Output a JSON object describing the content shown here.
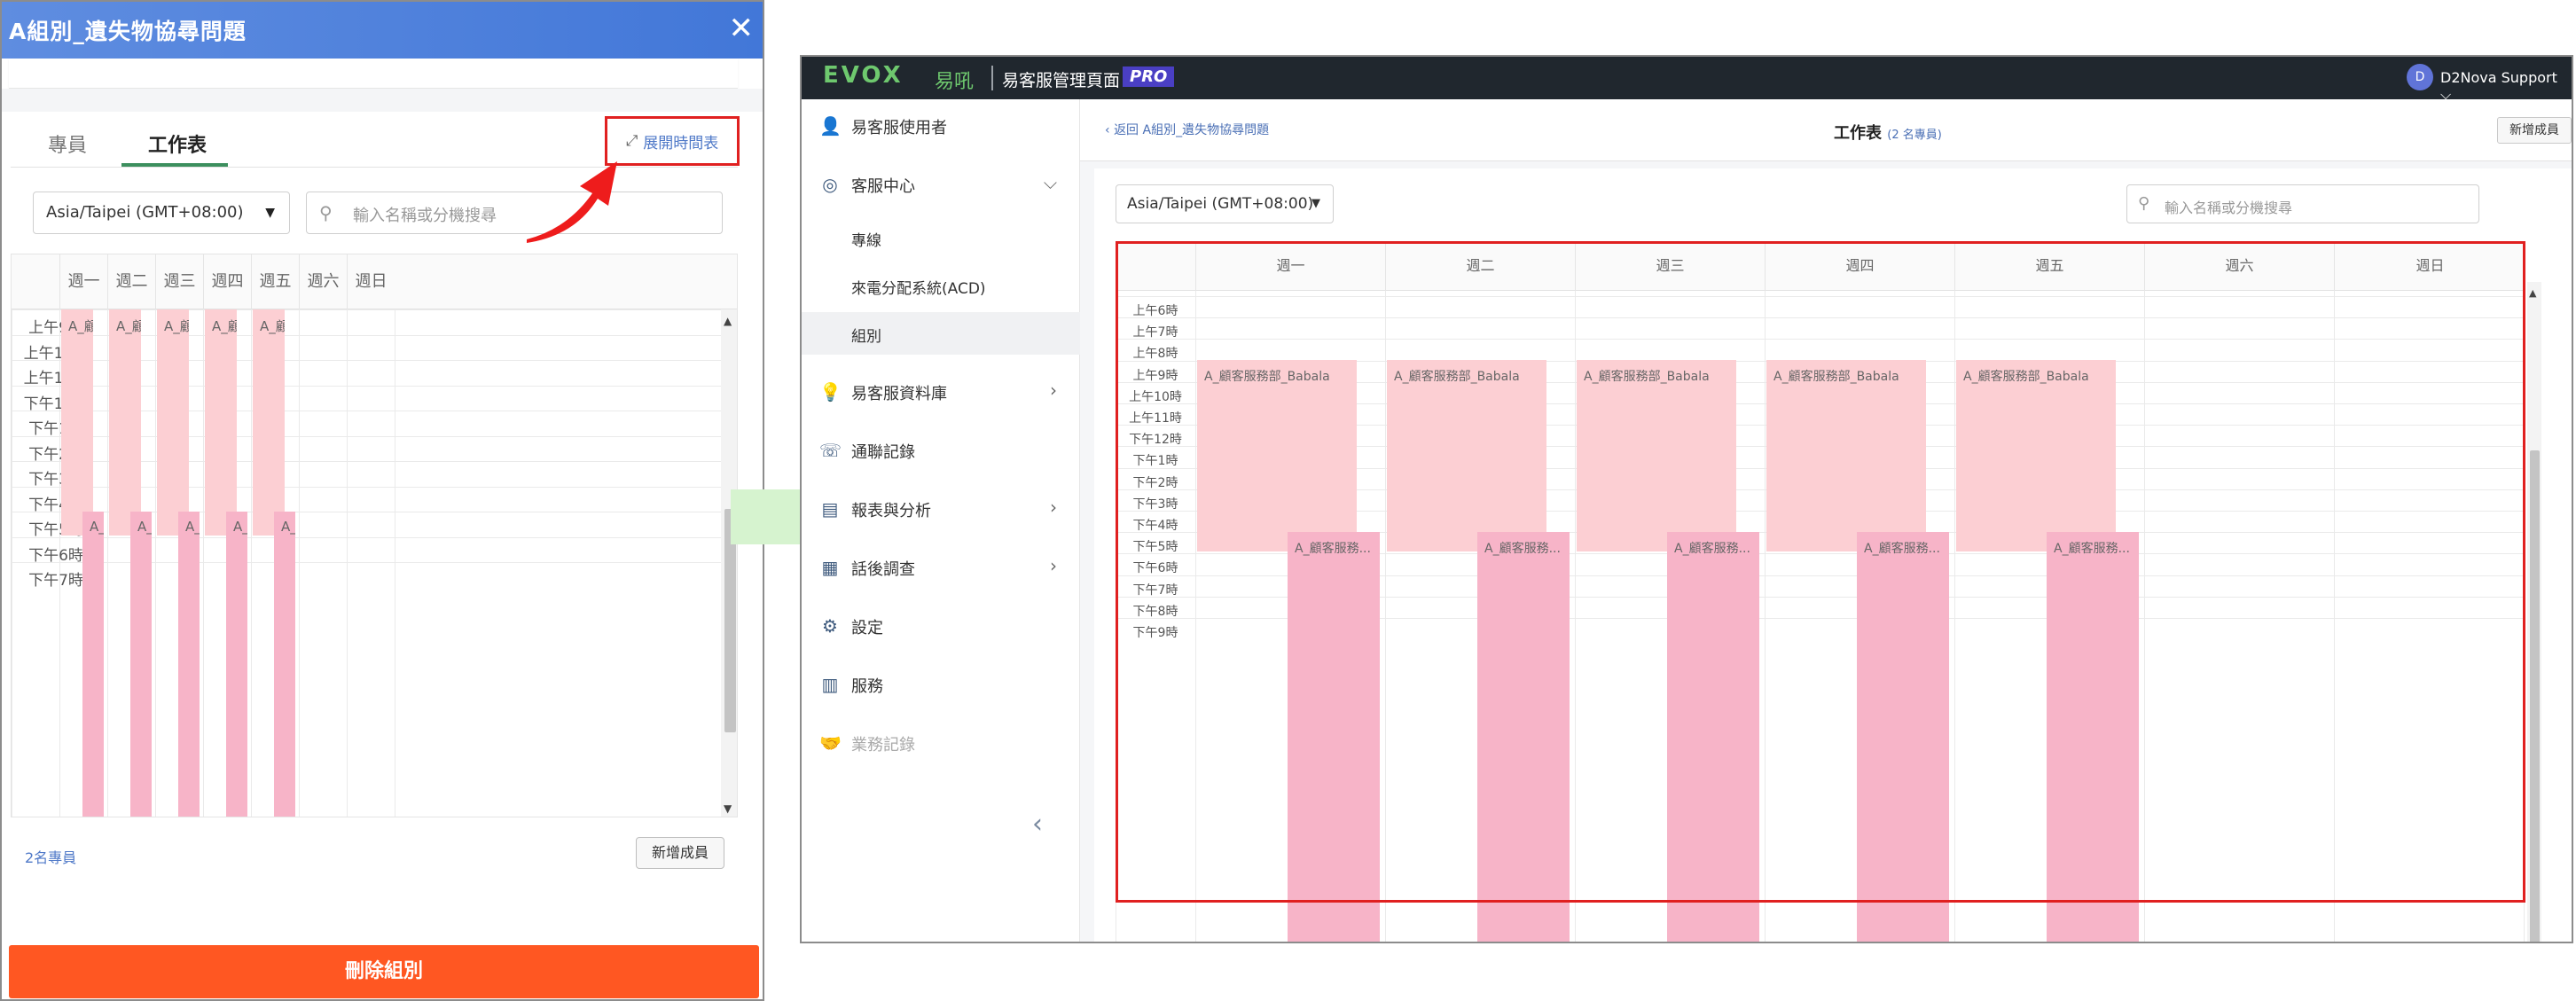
{
  "left_panel": {
    "title": "A組別_遺失物協尋問題",
    "close_label": "✕",
    "tabs": [
      {
        "label": "專員"
      },
      {
        "label": "工作表"
      }
    ],
    "expand_label": "展開時間表",
    "timezone": "Asia/Taipei (GMT+08:00)",
    "search_placeholder": "輸入名稱或分機搜尋",
    "days": [
      "週一",
      "週二",
      "週三",
      "週四",
      "週五",
      "週六",
      "週日"
    ],
    "hours": [
      "上午9時",
      "上午10時",
      "上午11時",
      "下午12時",
      "下午1時",
      "下午2時",
      "下午3時",
      "下午4時",
      "下午5時",
      "下午6時",
      "下午7時"
    ],
    "block_a_label": "A_顧...",
    "block_b_label": "A_...",
    "member_count": "2名專員",
    "add_member": "新增成員",
    "delete_group": "刪除組別"
  },
  "right_panel": {
    "logo": "EVOX",
    "logo_cn": "易吼",
    "app_title": "易客服管理頁面",
    "pro_badge": "PRO",
    "avatar_letter": "D",
    "user_name": "D2Nova Support ⌵",
    "sidebar": {
      "items": [
        {
          "label": "易客服使用者",
          "icon": "user-icon"
        },
        {
          "label": "客服中心",
          "icon": "headset-icon"
        },
        {
          "label": "易客服資料庫",
          "icon": "bulb-icon"
        },
        {
          "label": "通聯記錄",
          "icon": "phone-icon"
        },
        {
          "label": "報表與分析",
          "icon": "chart-icon"
        },
        {
          "label": "話後調查",
          "icon": "survey-icon"
        },
        {
          "label": "設定",
          "icon": "gear-icon"
        },
        {
          "label": "服務",
          "icon": "service-icon"
        },
        {
          "label": "業務記錄",
          "icon": "handshake-icon"
        }
      ],
      "subitems": [
        {
          "label": "專線"
        },
        {
          "label": "來電分配系統(ACD)"
        },
        {
          "label": "組別"
        }
      ]
    },
    "back_link": "返回 A組別_遺失物協尋問題",
    "worksheet_title": "工作表",
    "worksheet_count": "(2 名專員)",
    "add_member": "新增成員",
    "timezone": "Asia/Taipei (GMT+08:00)",
    "search_placeholder": "輸入名稱或分機搜尋",
    "days": [
      "週一",
      "週二",
      "週三",
      "週四",
      "週五",
      "週六",
      "週日"
    ],
    "hours": [
      "上午6時",
      "上午7時",
      "上午8時",
      "上午9時",
      "上午10時",
      "上午11時",
      "下午12時",
      "下午1時",
      "下午2時",
      "下午3時",
      "下午4時",
      "下午5時",
      "下午6時",
      "下午7時",
      "下午8時",
      "下午9時"
    ],
    "block_a_label": "A_顧客服務部_Babala",
    "block_b_label": "A_顧客服務..."
  },
  "colors": {
    "header_blue": "#4277d8",
    "block_a": "#fccfd3",
    "block_b": "#f7b4c8",
    "highlight_red": "#e02020",
    "delete_orange": "#ff5722",
    "arrow_green": "#d6f3cf"
  }
}
